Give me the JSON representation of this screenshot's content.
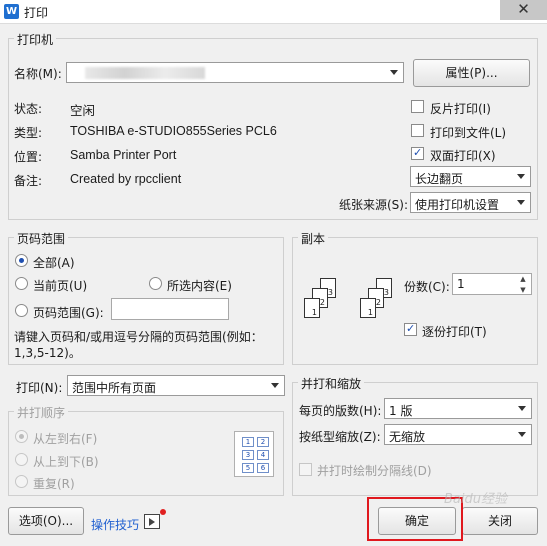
{
  "window": {
    "title": "打印",
    "app_icon": "W",
    "close_glyph": "✕"
  },
  "printer": {
    "legend": "打印机",
    "name_label": "名称(M):",
    "properties_button": "属性(P)...",
    "status_label": "状态:",
    "status_value": "空闲",
    "type_label": "类型:",
    "type_value": "TOSHIBA e-STUDIO855Series PCL6",
    "location_label": "位置:",
    "location_value": "Samba Printer Port",
    "comment_label": "备注:",
    "comment_value": "Created by rpcclient",
    "reverse_print": {
      "label": "反片打印(I)",
      "checked": false
    },
    "print_to_file": {
      "label": "打印到文件(L)",
      "checked": false
    },
    "duplex": {
      "label": "双面打印(X)",
      "checked": true
    },
    "duplex_mode": "长边翻页",
    "paper_source_label": "纸张来源(S):",
    "paper_source_value": "使用打印机设置"
  },
  "page_range": {
    "legend": "页码范围",
    "all": "全部(A)",
    "current": "当前页(U)",
    "selection": "所选内容(E)",
    "pages": "页码范围(G):",
    "hint": "请键入页码和/或用逗号分隔的页码范围(例如：1,3,5-12)。",
    "hint_line1": "请键入页码和/或用逗号分隔的页码范围(例如：",
    "hint_line2": "1,3,5-12)。"
  },
  "copies": {
    "legend": "副本",
    "count_label": "份数(C):",
    "count_value": "1",
    "collate": {
      "label": "逐份打印(T)",
      "checked": true
    }
  },
  "print_what": {
    "label": "打印(N):",
    "value": "范围中所有页面"
  },
  "order": {
    "legend": "并打顺序",
    "left_to_right": "从左到右(F)",
    "top_to_bottom": "从上到下(B)",
    "repeat": "重复(R)",
    "cells": [
      "1",
      "2",
      "3",
      "4",
      "5",
      "6"
    ]
  },
  "zoom": {
    "legend": "并打和缩放",
    "pages_per_sheet_label": "每页的版数(H):",
    "pages_per_sheet_value": "1 版",
    "scale_label": "按纸型缩放(Z):",
    "scale_value": "无缩放",
    "draw_lines": {
      "label": "并打时绘制分隔线(D)",
      "checked": false
    }
  },
  "footer": {
    "options_button": "选项(O)...",
    "tips_link": "操作技巧",
    "ok_button": "确定",
    "close_button": "关闭"
  },
  "watermark": "Baidu经验",
  "colors": {
    "highlight": "#e0181e",
    "link": "#1f5fd0",
    "checkbox_mark": "#1f4fb0"
  }
}
